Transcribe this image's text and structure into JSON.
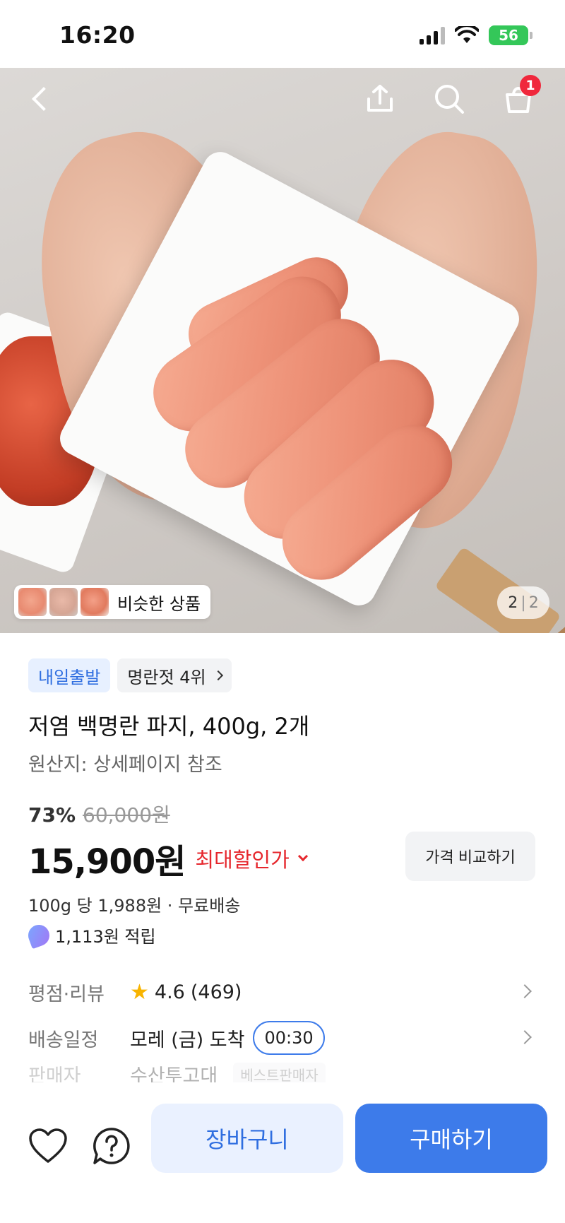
{
  "status_bar": {
    "time": "16:20",
    "battery": "56"
  },
  "header": {
    "cart_count": "1"
  },
  "gallery": {
    "similar_label": "비슷한 상품",
    "current_page": "2",
    "total_pages": "2"
  },
  "badges": {
    "delivery": "내일출발",
    "rank": "명란젓 4위"
  },
  "product": {
    "title": "저염 백명란 파지, 400g, 2개",
    "origin": "원산지: 상세페이지 참조",
    "discount_percent": "73%",
    "original_price": "60,000원",
    "price": "15,900원",
    "max_discount_label": "최대할인가",
    "compare_button": "가격 비교하기",
    "unit_price": "100g 당 1,988원 · 무료배송",
    "points": "1,113원 적립"
  },
  "info": {
    "rating_label": "평점·리뷰",
    "rating_value": "4.6",
    "review_count": "(469)",
    "delivery_label": "배송일정",
    "delivery_value": "모레 (금) 도착",
    "delivery_time": "00:30",
    "seller_label": "판매자",
    "seller_value": "수산투고대",
    "seller_tag": "베스트판매자"
  },
  "bottom_bar": {
    "cart_button": "장바구니",
    "buy_button": "구매하기"
  },
  "colors": {
    "accent": "#3d7bea",
    "sale_red": "#e6272d",
    "star": "#f8b400",
    "badge_blue_bg": "#e7f0ff"
  }
}
